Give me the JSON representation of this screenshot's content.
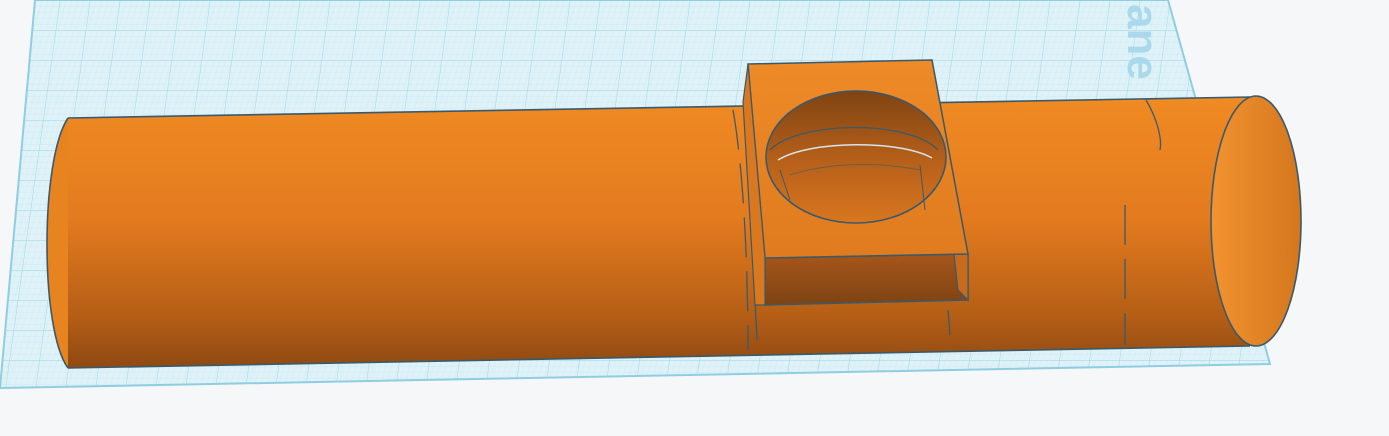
{
  "workplane": {
    "label": "ane",
    "grid_color": "#9fd7e8",
    "fine_grid_color": "#cdeaf3",
    "plane_color": "#dff2f8"
  },
  "model": {
    "shape_color": "#ef8a26",
    "shade_color": "#9a4f12",
    "edge_color": "#3a5a6c",
    "components": [
      "cylinder",
      "box-with-hole"
    ]
  }
}
